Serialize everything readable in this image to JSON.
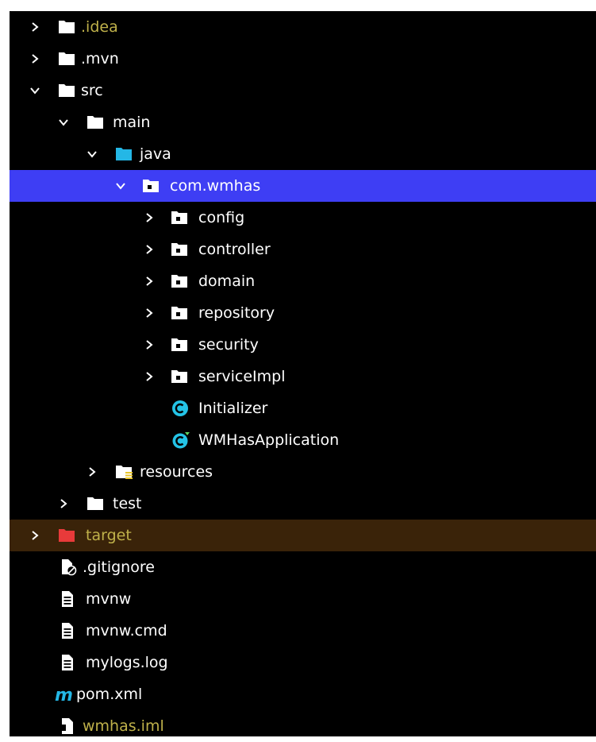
{
  "colors": {
    "background": "#000000",
    "text": "#ffffff",
    "selected_row": "#3e3ef4",
    "excluded_row": "#3a2309",
    "ignored_text": "#bfb14a",
    "source_folder": "#24b7e6",
    "excluded_folder": "#e83a3a",
    "class_icon": "#24c3e6",
    "maven_icon": "#24b7e6"
  },
  "tree": {
    "rows": [
      {
        "label": ".idea",
        "icon": "folder-icon",
        "expanded": false,
        "ignored": true
      },
      {
        "label": ".mvn",
        "icon": "folder-icon",
        "expanded": false
      },
      {
        "label": "src",
        "icon": "folder-icon",
        "expanded": true
      },
      {
        "label": "main",
        "icon": "folder-icon",
        "expanded": true
      },
      {
        "label": "java",
        "icon": "source-folder-icon",
        "expanded": true
      },
      {
        "label": "com.wmhas",
        "icon": "package-icon",
        "expanded": true,
        "selected": true
      },
      {
        "label": "config",
        "icon": "package-icon",
        "expanded": false
      },
      {
        "label": "controller",
        "icon": "package-icon",
        "expanded": false
      },
      {
        "label": "domain",
        "icon": "package-icon",
        "expanded": false
      },
      {
        "label": "repository",
        "icon": "package-icon",
        "expanded": false
      },
      {
        "label": "security",
        "icon": "package-icon",
        "expanded": false
      },
      {
        "label": "serviceImpl",
        "icon": "package-icon",
        "expanded": false
      },
      {
        "label": "Initializer",
        "icon": "java-class-icon"
      },
      {
        "label": "WMHasApplication",
        "icon": "spring-boot-class-icon"
      },
      {
        "label": "resources",
        "icon": "resources-folder-icon",
        "expanded": false
      },
      {
        "label": "test",
        "icon": "folder-icon",
        "expanded": false
      },
      {
        "label": "target",
        "icon": "excluded-folder-icon",
        "expanded": false,
        "excluded": true
      },
      {
        "label": ".gitignore",
        "icon": "ignore-file-icon"
      },
      {
        "label": "mvnw",
        "icon": "text-file-icon"
      },
      {
        "label": "mvnw.cmd",
        "icon": "text-file-icon"
      },
      {
        "label": "mylogs.log",
        "icon": "text-file-icon"
      },
      {
        "label": "pom.xml",
        "icon": "maven-icon"
      },
      {
        "label": "wmhas.iml",
        "icon": "module-file-icon",
        "ignored": true
      }
    ]
  }
}
